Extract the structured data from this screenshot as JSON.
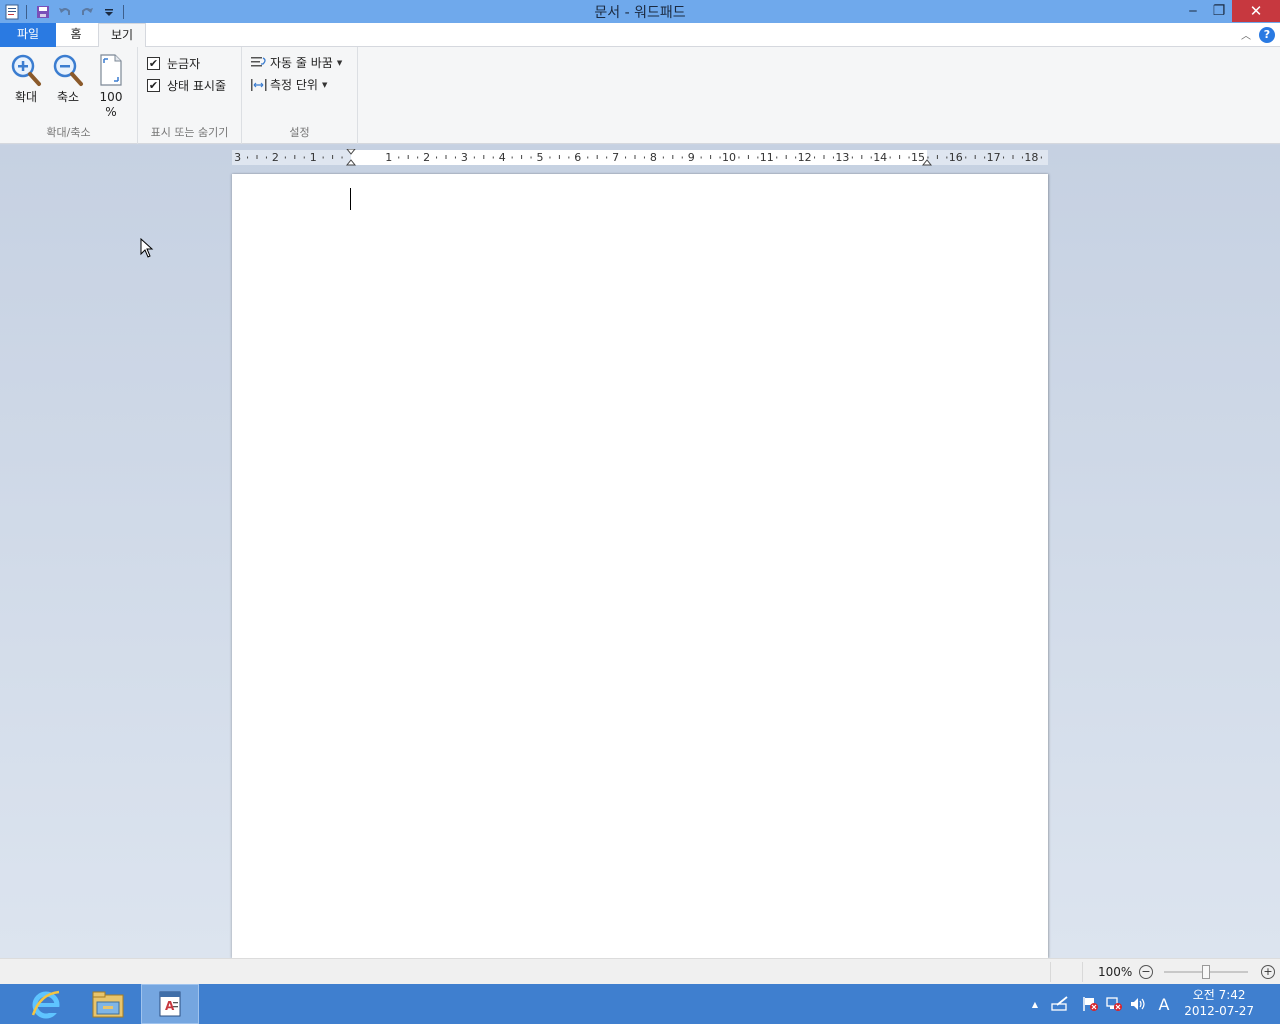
{
  "window": {
    "title": "문서 - 워드패드",
    "minimize_symbol": "‒",
    "restore_symbol": "❐",
    "close_symbol": "✕"
  },
  "tabs": {
    "file": "파일",
    "home": "홈",
    "view": "보기",
    "collapse_symbol": "︿",
    "help_symbol": "?"
  },
  "ribbon": {
    "zoom_group": {
      "label": "확대/축소",
      "zoom_in": "확대",
      "zoom_out": "축소",
      "hundred_line1": "100",
      "hundred_line2": "%"
    },
    "show_group": {
      "label": "표시 또는 숨기기",
      "ruler": {
        "label": "눈금자",
        "checked": true
      },
      "statusbar": {
        "label": "상태 표시줄",
        "checked": true
      }
    },
    "settings_group": {
      "label": "설정",
      "word_wrap": "자동 줄 바꿈",
      "measurement_units": "측정 단위"
    }
  },
  "ruler": {
    "labels": [
      "3",
      "2",
      "1",
      "1",
      "2",
      "3",
      "4",
      "5",
      "6",
      "7",
      "8",
      "9",
      "10",
      "11",
      "12",
      "13",
      "14",
      "15",
      "16",
      "17",
      "18"
    ]
  },
  "statusbar": {
    "zoom_percent": "100%",
    "zoom_level": 100,
    "zoom_out_symbol": "−",
    "zoom_in_symbol": "+"
  },
  "taskbar": {
    "items": [
      "internet-explorer-icon",
      "file-explorer-icon",
      "wordpad-icon"
    ],
    "tray_arrow": "▲",
    "ime": "A",
    "clock_time": "오전 7:42",
    "clock_date": "2012-07-27"
  },
  "colors": {
    "titlebar": "#6fa9ec",
    "file_tab": "#2a7ae2",
    "taskbar": "#3f7fcf",
    "close": "#c7383f"
  }
}
